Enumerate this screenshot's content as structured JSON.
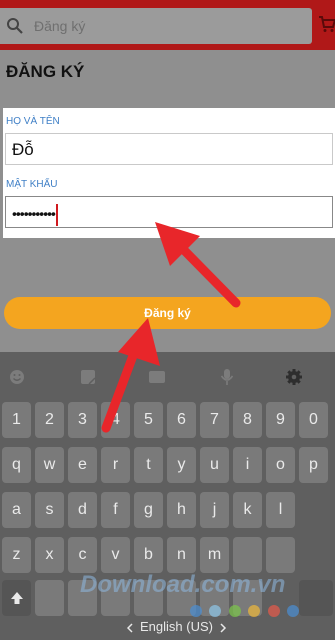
{
  "search": {
    "placeholder": "Đăng ký"
  },
  "page": {
    "title": "ĐĂNG KÝ"
  },
  "form": {
    "name_label": "HỌ VÀ TÊN",
    "name_value": "Đỗ",
    "password_label": "MẬT KHẨU",
    "password_value": "•••••••••••"
  },
  "register_button": {
    "label": "Đăng ký"
  },
  "keyboard": {
    "row1": [
      "1",
      "2",
      "3",
      "4",
      "5",
      "6",
      "7",
      "8",
      "9",
      "0"
    ],
    "row2": [
      "q",
      "w",
      "e",
      "r",
      "t",
      "y",
      "u",
      "i",
      "o",
      "p"
    ],
    "row3": [
      "a",
      "s",
      "d",
      "f",
      "g",
      "h",
      "j",
      "k",
      "l"
    ],
    "row4": [
      "z",
      "x",
      "c",
      "v",
      "b",
      "n",
      "m"
    ],
    "space_label": "English (US)",
    "toolbar_icons": [
      "emoji-icon",
      "sticker-icon",
      "gif-icon",
      "microphone-icon",
      "settings-icon"
    ]
  },
  "watermark": {
    "text": "Download.com.vn"
  },
  "colors": {
    "header": "#b01818",
    "accent_button": "#f4a51f",
    "label_blue": "#3f7fc6",
    "annotation_arrow": "#e8262a"
  }
}
